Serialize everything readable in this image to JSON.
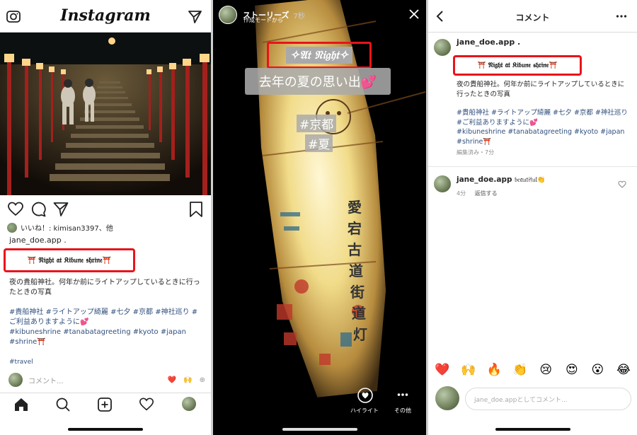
{
  "feed": {
    "logo": "Instagram",
    "likes_text": "いいね！: kimisan3397、他",
    "username": "jane_doe.app .",
    "title": "⛩️ 𝔑𝔦𝔤𝔥𝔱 𝔞𝔱 𝔎𝔦𝔟𝔲𝔫𝔢 𝔰𝔥𝔯𝔦𝔫𝔢⛩️",
    "caption_line1": "夜の貴船神社。何年か前にライトアップしているときに行ったときの写真",
    "hashtags1": "#貴船神社 #ライトアップ綺麗 #七夕 #京都 #神社巡り #ご利益ありますように💕",
    "hashtags2": "#kibuneshrine #tanabatagreeting #kyoto #japan #shrine⛩️",
    "hashtag_travel": "#travel",
    "comment_placeholder": "コメント...",
    "reactions": [
      "❤️",
      "🙌",
      "⊕"
    ]
  },
  "story": {
    "label": "ストーリーズ",
    "time": "7秒",
    "subtitle": "作成モードから",
    "night_text": "✧𝔄𝔱 𝔑𝔦𝔤𝔥𝔱✧",
    "memory_text": "去年の夏の思い出💕",
    "tag1": "#京都",
    "tag2": "#夏",
    "highlight_label": "ハイライト",
    "other_label": "その他"
  },
  "comments": {
    "header_title": "コメント",
    "post_user": "jane_doe.app .",
    "title": "⛩️ 𝔑𝔦𝔤𝔥𝔱 𝔞𝔱 𝔎𝔦𝔟𝔲𝔫𝔢 𝔰𝔥𝔯𝔦𝔫𝔢⛩️",
    "caption_line1": "夜の貴船神社。何年か前にライトアップしているときに行ったときの写真",
    "hashtags_jp": "#貴船神社 #ライトアップ綺麗 #七夕 #京都 #神社巡り #ご利益ありますように💕",
    "hashtags_en": "#kibuneshrine #tanabatagreeting #kyoto #japan #shrine⛩️",
    "edited_meta": "編集済み・7分",
    "reply_user": "jane_doe.app",
    "reply_text": "𝔟𝔢𝔞𝔲𝔱𝔦𝔣𝔲𝔩👏",
    "reply_time": "4分",
    "reply_action": "返信する",
    "emojis": [
      "❤️",
      "🙌",
      "🔥",
      "👏",
      "😢",
      "😍",
      "😮",
      "😂"
    ],
    "input_placeholder": "jane_doe.appとしてコメント..."
  },
  "colors": {
    "highlight_border": "#e8141b",
    "hashtag": "#31507e",
    "text": "#262626",
    "meta": "#8e8e8e"
  }
}
